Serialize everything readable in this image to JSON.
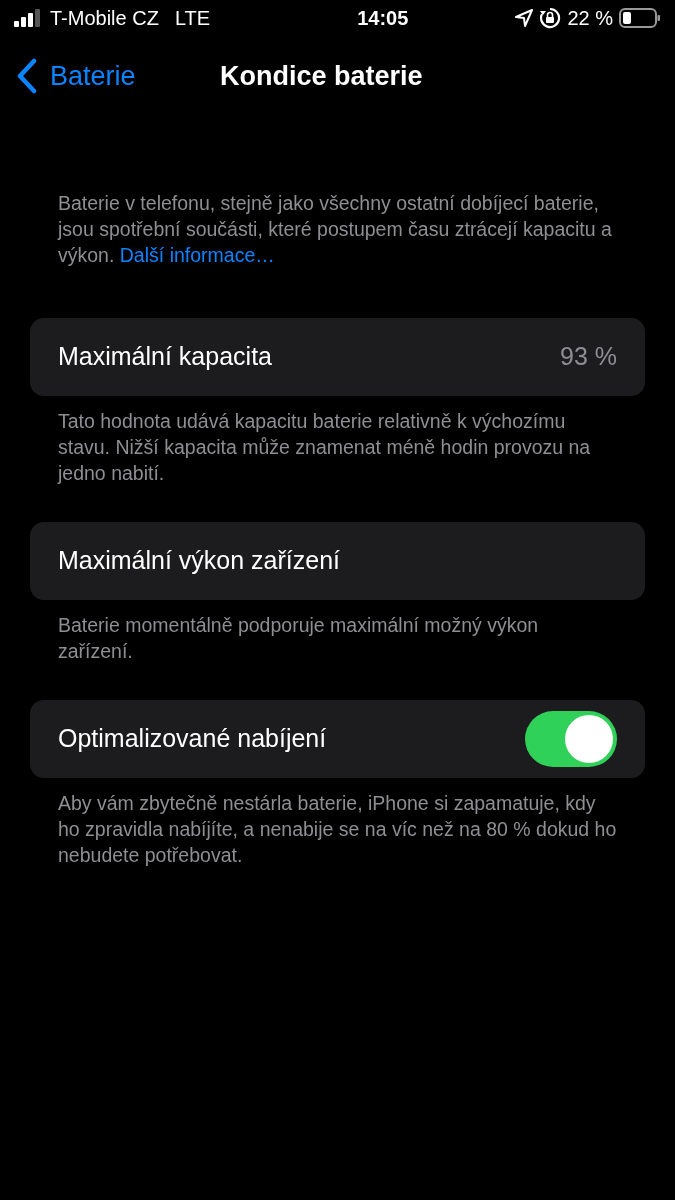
{
  "status_bar": {
    "carrier": "T-Mobile CZ",
    "network": "LTE",
    "time": "14:05",
    "battery": "22 %"
  },
  "nav": {
    "back": "Baterie",
    "title": "Kondice baterie"
  },
  "intro": {
    "text": "Baterie v telefonu, stejně jako všechny ostatní dobíjecí baterie, jsou spotřební součásti, které postupem času ztrácejí kapacitu a výkon.",
    "link": "Další informace…"
  },
  "sections": [
    {
      "kind": "value",
      "label": "Maximální kapacita",
      "value": "93 %",
      "footer": "Tato hodnota udává kapacitu baterie relativně k výchozímu stavu. Nižší kapacita může znamenat méně hodin provozu na jedno nabití."
    },
    {
      "kind": "plain",
      "label": "Maximální výkon zařízení",
      "footer": "Baterie momentálně podporuje maximální možný výkon zařízení."
    },
    {
      "kind": "toggle",
      "label": "Optimalizované nabíjení",
      "on": true,
      "footer": "Aby vám zbytečně nestárla baterie, iPhone si zapamatuje, kdy ho zpravidla nabíjíte, a nenabije se na víc než na 80 % dokud ho nebudete potřebovat."
    }
  ]
}
